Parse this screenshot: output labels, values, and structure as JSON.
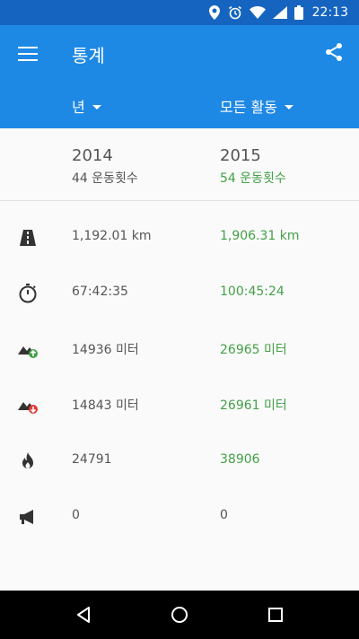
{
  "status_bar": {
    "time": "22:13"
  },
  "app_bar": {
    "title": "통계"
  },
  "filters": {
    "year_label": "년",
    "activity_label": "모든 활동"
  },
  "columns": [
    {
      "year": "2014",
      "count": "44 운동횟수"
    },
    {
      "year": "2015",
      "count": "54 운동횟수"
    }
  ],
  "stats": [
    {
      "icon": "road-icon",
      "a": "1,192.01 km",
      "b": "1,906.31 km"
    },
    {
      "icon": "stopwatch-icon",
      "a": "67:42:35",
      "b": "100:45:24"
    },
    {
      "icon": "elevation-gain-icon",
      "a": "14936 미터",
      "b": "26965 미터"
    },
    {
      "icon": "elevation-loss-icon",
      "a": "14843 미터",
      "b": "26961 미터"
    },
    {
      "icon": "fire-icon",
      "a": "24791",
      "b": "38906"
    },
    {
      "icon": "megaphone-icon",
      "a": "0",
      "b": "0"
    }
  ],
  "colors": {
    "status_bar": "#1565c0",
    "app_bar": "#1e88e5",
    "accent_green": "#43a047"
  }
}
